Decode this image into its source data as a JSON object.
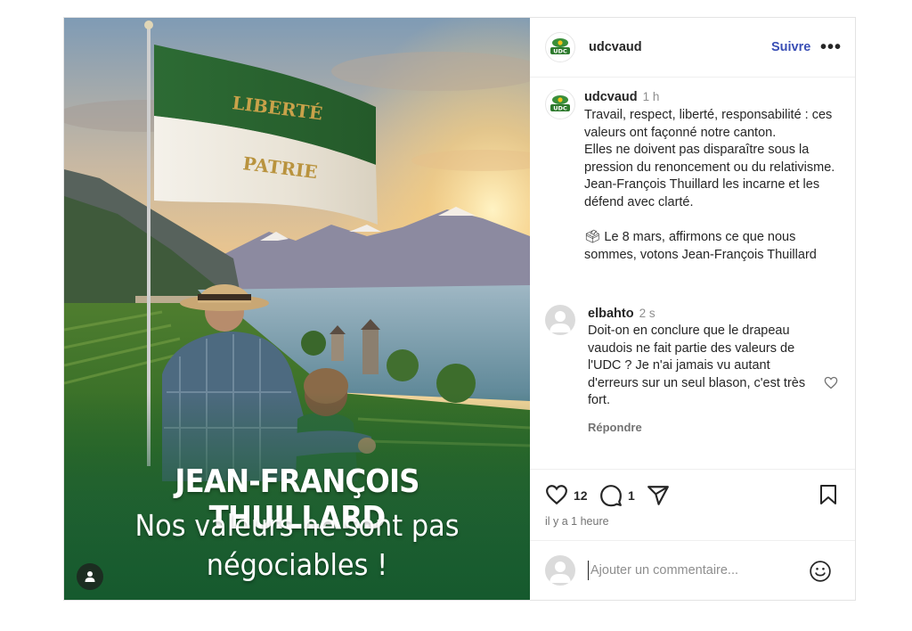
{
  "post": {
    "image": {
      "flag_line1": "LIBERTÉ",
      "flag_line2": "PATRIE",
      "headline": "JEAN-FRANÇOIS THUILLARD",
      "subline1": "Nos valeurs ne sont pas",
      "subline2": "négociables !"
    },
    "header": {
      "username": "udcvaud",
      "follow_label": "Suivre",
      "more_label": "•••"
    },
    "caption": {
      "username": "udcvaud",
      "time": "1 h",
      "lines": [
        "Travail, respect, liberté, responsabilité : ces valeurs ont façonné notre canton.",
        "Elles ne doivent pas disparaître sous la pression du renoncement ou du relativisme.",
        "Jean-François Thuillard les incarne et les défend avec clarté.",
        "",
        "🗳 Le 8 mars, affirmons ce que nous sommes, votons Jean-François Thuillard"
      ]
    },
    "comment": {
      "username": "elbahto",
      "time": "2 s",
      "text": "Doit-on en conclure que le drapeau vaudois ne fait partie des valeurs de l'UDC ? Je n'ai jamais vu autant d'erreurs sur un seul blason, c'est très fort.",
      "reply_label": "Répondre"
    },
    "actions": {
      "likes": "12",
      "comments": "1",
      "posted_ago": "il y a 1 heure"
    },
    "add_comment": {
      "placeholder": "Ajouter un commentaire..."
    },
    "icons": [
      "udc-logo-icon",
      "heart-icon",
      "comment-icon",
      "share-icon",
      "bookmark-icon",
      "emoji-icon",
      "user-tag-icon",
      "more-icon"
    ],
    "colors": {
      "follow": "#3a4fb5",
      "flag_green": "#2e6b35",
      "gold_text": "#c9a24a"
    }
  }
}
